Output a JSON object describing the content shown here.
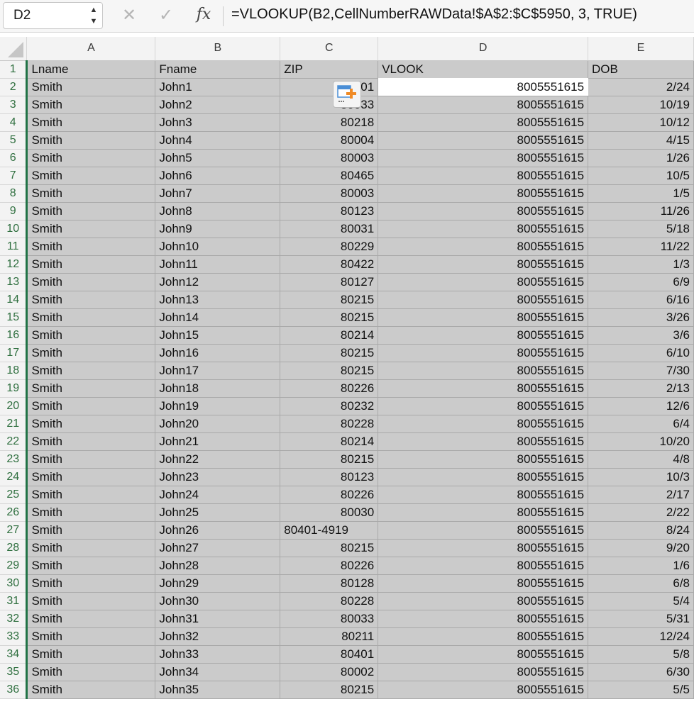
{
  "formula_bar": {
    "name_box": "D2",
    "cancel_glyph": "✕",
    "enter_glyph": "✓",
    "fx_label": "fx",
    "formula": "=VLOOKUP(B2,CellNumberRAWData!$A$2:$C$5950, 3, TRUE)"
  },
  "columns": [
    "A",
    "B",
    "C",
    "D",
    "E"
  ],
  "active_cell": "D2",
  "rows": [
    {
      "num": "1",
      "cells": [
        "Lname",
        "Fname",
        "ZIP",
        "VLOOK",
        "DOB"
      ]
    },
    {
      "num": "2",
      "cells": [
        "Smith",
        "John1",
        "01",
        "8005551615",
        "2/24"
      ]
    },
    {
      "num": "3",
      "cells": [
        "Smith",
        "John2",
        "80033",
        "8005551615",
        "10/19"
      ]
    },
    {
      "num": "4",
      "cells": [
        "Smith",
        "John3",
        "80218",
        "8005551615",
        "10/12"
      ]
    },
    {
      "num": "5",
      "cells": [
        "Smith",
        "John4",
        "80004",
        "8005551615",
        "4/15"
      ]
    },
    {
      "num": "6",
      "cells": [
        "Smith",
        "John5",
        "80003",
        "8005551615",
        "1/26"
      ]
    },
    {
      "num": "7",
      "cells": [
        "Smith",
        "John6",
        "80465",
        "8005551615",
        "10/5"
      ]
    },
    {
      "num": "8",
      "cells": [
        "Smith",
        "John7",
        "80003",
        "8005551615",
        "1/5"
      ]
    },
    {
      "num": "9",
      "cells": [
        "Smith",
        "John8",
        "80123",
        "8005551615",
        "11/26"
      ]
    },
    {
      "num": "10",
      "cells": [
        "Smith",
        "John9",
        "80031",
        "8005551615",
        "5/18"
      ]
    },
    {
      "num": "11",
      "cells": [
        "Smith",
        "John10",
        "80229",
        "8005551615",
        "11/22"
      ]
    },
    {
      "num": "12",
      "cells": [
        "Smith",
        "John11",
        "80422",
        "8005551615",
        "1/3"
      ]
    },
    {
      "num": "13",
      "cells": [
        "Smith",
        "John12",
        "80127",
        "8005551615",
        "6/9"
      ]
    },
    {
      "num": "14",
      "cells": [
        "Smith",
        "John13",
        "80215",
        "8005551615",
        "6/16"
      ]
    },
    {
      "num": "15",
      "cells": [
        "Smith",
        "John14",
        "80215",
        "8005551615",
        "3/26"
      ]
    },
    {
      "num": "16",
      "cells": [
        "Smith",
        "John15",
        "80214",
        "8005551615",
        "3/6"
      ]
    },
    {
      "num": "17",
      "cells": [
        "Smith",
        "John16",
        "80215",
        "8005551615",
        "6/10"
      ]
    },
    {
      "num": "18",
      "cells": [
        "Smith",
        "John17",
        "80215",
        "8005551615",
        "7/30"
      ]
    },
    {
      "num": "19",
      "cells": [
        "Smith",
        "John18",
        "80226",
        "8005551615",
        "2/13"
      ]
    },
    {
      "num": "20",
      "cells": [
        "Smith",
        "John19",
        "80232",
        "8005551615",
        "12/6"
      ]
    },
    {
      "num": "21",
      "cells": [
        "Smith",
        "John20",
        "80228",
        "8005551615",
        "6/4"
      ]
    },
    {
      "num": "22",
      "cells": [
        "Smith",
        "John21",
        "80214",
        "8005551615",
        "10/20"
      ]
    },
    {
      "num": "23",
      "cells": [
        "Smith",
        "John22",
        "80215",
        "8005551615",
        "4/8"
      ]
    },
    {
      "num": "24",
      "cells": [
        "Smith",
        "John23",
        "80123",
        "8005551615",
        "10/3"
      ]
    },
    {
      "num": "25",
      "cells": [
        "Smith",
        "John24",
        "80226",
        "8005551615",
        "2/17"
      ]
    },
    {
      "num": "26",
      "cells": [
        "Smith",
        "John25",
        "80030",
        "8005551615",
        "2/22"
      ]
    },
    {
      "num": "27",
      "cells": [
        "Smith",
        "John26",
        "80401-4919",
        "8005551615",
        "8/24"
      ]
    },
    {
      "num": "28",
      "cells": [
        "Smith",
        "John27",
        "80215",
        "8005551615",
        "9/20"
      ]
    },
    {
      "num": "29",
      "cells": [
        "Smith",
        "John28",
        "80226",
        "8005551615",
        "1/6"
      ]
    },
    {
      "num": "30",
      "cells": [
        "Smith",
        "John29",
        "80128",
        "8005551615",
        "6/8"
      ]
    },
    {
      "num": "31",
      "cells": [
        "Smith",
        "John30",
        "80228",
        "8005551615",
        "5/4"
      ]
    },
    {
      "num": "32",
      "cells": [
        "Smith",
        "John31",
        "80033",
        "8005551615",
        "5/31"
      ]
    },
    {
      "num": "33",
      "cells": [
        "Smith",
        "John32",
        "80211",
        "8005551615",
        "12/24"
      ]
    },
    {
      "num": "34",
      "cells": [
        "Smith",
        "John33",
        "80401",
        "8005551615",
        "5/8"
      ]
    },
    {
      "num": "35",
      "cells": [
        "Smith",
        "John34",
        "80002",
        "8005551615",
        "6/30"
      ]
    },
    {
      "num": "36",
      "cells": [
        "Smith",
        "John35",
        "80215",
        "8005551615",
        "5/5"
      ]
    }
  ],
  "icons": {
    "paste_options": "paste-options-icon",
    "cancel": "close-icon",
    "enter": "checkmark-icon",
    "stepper": "stepper-icon"
  },
  "colors": {
    "grid_fill": "#cbcbcb",
    "active_cell": "#ffffff",
    "row_header_accent": "#217346",
    "paste_icon_orange": "#f08a24",
    "paste_icon_blue": "#4a8ed6"
  }
}
